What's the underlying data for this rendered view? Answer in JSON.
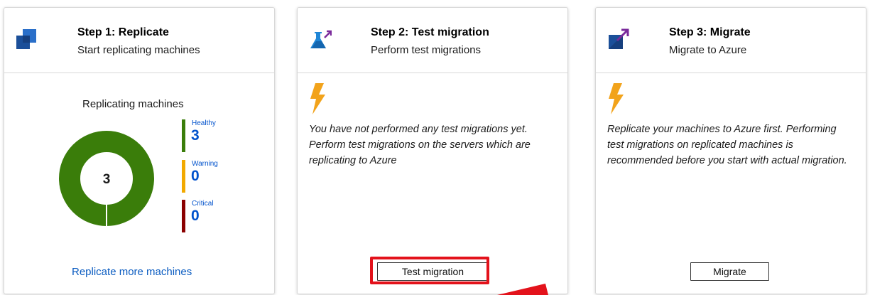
{
  "steps": [
    {
      "title": "Step 1: Replicate",
      "subtitle": "Start replicating machines",
      "icon": "replicate-icon"
    },
    {
      "title": "Step 2: Test migration",
      "subtitle": "Perform test migrations",
      "icon": "flask-icon",
      "message": "You have not performed any test migrations yet. Perform test migrations on the servers which are replicating to Azure",
      "button_label": "Test migration"
    },
    {
      "title": "Step 3: Migrate",
      "subtitle": "Migrate to Azure",
      "icon": "migrate-icon",
      "message": "Replicate your machines to Azure first. Performing test migrations on replicated machines is recommended before you start with actual migration.",
      "button_label": "Migrate"
    }
  ],
  "replication": {
    "title": "Replicating machines",
    "total": "3",
    "link_label": "Replicate more machines",
    "status": [
      {
        "label": "Healthy",
        "value": "3",
        "color": "#3a7d0a"
      },
      {
        "label": "Warning",
        "value": "0",
        "color": "#f2a900"
      },
      {
        "label": "Critical",
        "value": "0",
        "color": "#8b0000"
      }
    ]
  },
  "colors": {
    "donut_healthy": "#3a7d0a",
    "link": "#0b5cc1",
    "value_text": "#0052cc",
    "bolt": "#f2a31b",
    "highlight": "#e3121b"
  }
}
